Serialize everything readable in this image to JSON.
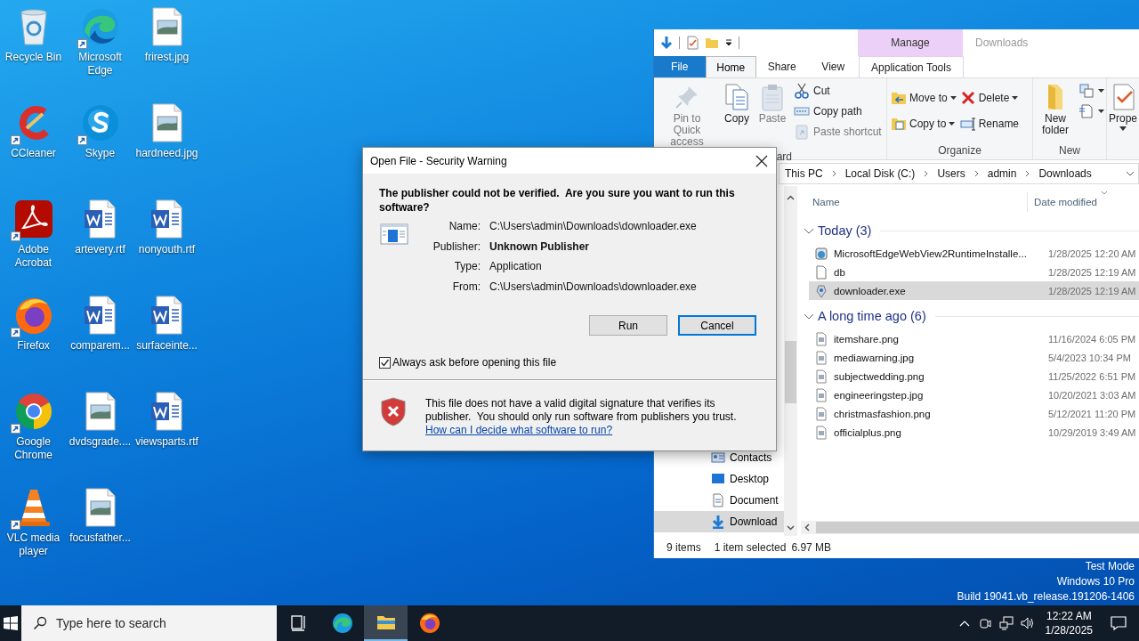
{
  "desktop_icons": [
    {
      "label": "Recycle Bin",
      "kind": "recycle-bin",
      "shortcut": false
    },
    {
      "label": "CCleaner",
      "kind": "ccleaner",
      "shortcut": true
    },
    {
      "label": "Adobe Acrobat",
      "kind": "acrobat",
      "shortcut": true
    },
    {
      "label": "Firefox",
      "kind": "firefox",
      "shortcut": true
    },
    {
      "label": "Google Chrome",
      "kind": "chrome",
      "shortcut": true
    },
    {
      "label": "VLC media player",
      "kind": "vlc",
      "shortcut": true
    },
    {
      "label": "Microsoft Edge",
      "kind": "edge",
      "shortcut": true
    },
    {
      "label": "Skype",
      "kind": "skype",
      "shortcut": true
    },
    {
      "label": "artevery.rtf",
      "kind": "word",
      "shortcut": false
    },
    {
      "label": "comparem...",
      "kind": "word",
      "shortcut": false
    },
    {
      "label": "dvdsgrade....",
      "kind": "image",
      "shortcut": false
    },
    {
      "label": "focusfather...",
      "kind": "image",
      "shortcut": false
    },
    {
      "label": "frirest.jpg",
      "kind": "image",
      "shortcut": false
    },
    {
      "label": "hardneed.jpg",
      "kind": "image",
      "shortcut": false
    },
    {
      "label": "nonyouth.rtf",
      "kind": "word",
      "shortcut": false
    },
    {
      "label": "surfaceinte...",
      "kind": "word",
      "shortcut": false
    },
    {
      "label": "viewsparts.rtf",
      "kind": "word",
      "shortcut": false
    }
  ],
  "explorer": {
    "title": "Downloads",
    "contextual_group": "Manage",
    "tabs": [
      {
        "label": "File",
        "kind": "file",
        "selected": false
      },
      {
        "label": "Home",
        "kind": "normal",
        "selected": true
      },
      {
        "label": "Share",
        "kind": "normal",
        "selected": false
      },
      {
        "label": "View",
        "kind": "normal",
        "selected": false
      },
      {
        "label": "Application Tools",
        "kind": "contextual",
        "selected": false
      }
    ],
    "ribbon_groups": [
      {
        "label": "ard",
        "items": [
          {
            "kind": "large",
            "label": "Pin to Quick access",
            "disabled": true,
            "dropdown": false
          },
          {
            "kind": "large",
            "label": "Copy",
            "disabled": false,
            "dropdown": false
          },
          {
            "kind": "large",
            "label": "Paste",
            "disabled": true,
            "dropdown": false
          },
          {
            "kind": "stack",
            "items": [
              {
                "label": "Cut",
                "disabled": false,
                "dropdown": false
              },
              {
                "label": "Copy path",
                "disabled": false,
                "dropdown": false
              },
              {
                "label": "Paste shortcut",
                "disabled": true,
                "dropdown": false
              }
            ]
          }
        ]
      },
      {
        "label": "Organize",
        "items": [
          {
            "kind": "stack",
            "items": [
              {
                "label": "Move to",
                "disabled": false,
                "dropdown": true
              },
              {
                "label": "Copy to",
                "disabled": false,
                "dropdown": true
              }
            ]
          },
          {
            "kind": "stack",
            "items": [
              {
                "label": "Delete",
                "disabled": false,
                "dropdown": true
              },
              {
                "label": "Rename",
                "disabled": false,
                "dropdown": false
              }
            ]
          }
        ]
      },
      {
        "label": "New",
        "items": [
          {
            "kind": "large",
            "label": "New folder",
            "disabled": false,
            "dropdown": false
          },
          {
            "kind": "stack",
            "items": [
              {
                "disabled": false,
                "dropdown": true
              },
              {
                "disabled": false,
                "dropdown": true
              }
            ]
          }
        ]
      },
      {
        "items": [
          {
            "kind": "large",
            "label": "Prope",
            "disabled": false,
            "dropdown": true
          }
        ]
      }
    ],
    "address": [
      "This PC",
      "Local Disk (C:)",
      "Users",
      "admin",
      "Downloads"
    ],
    "nav_items": [
      {
        "label": "Contacts",
        "selected": false
      },
      {
        "label": "Desktop",
        "selected": false
      },
      {
        "label": "Document",
        "selected": false
      },
      {
        "label": "Download",
        "selected": true
      }
    ],
    "columns": [
      "Name",
      "Date modified"
    ],
    "groups": [
      {
        "label": "Today (3)",
        "expanded": true,
        "files": [
          {
            "name": "MicrosoftEdgeWebView2RuntimeInstalle...",
            "modified": "1/28/2025 12:20 AM",
            "kind": "installer",
            "selected": false
          },
          {
            "name": "db",
            "modified": "1/28/2025 12:19 AM",
            "kind": "blank",
            "selected": false
          },
          {
            "name": "downloader.exe",
            "modified": "1/28/2025 12:19 AM",
            "kind": "exe",
            "selected": true
          }
        ]
      },
      {
        "label": "A long time ago (6)",
        "expanded": true,
        "files": [
          {
            "name": "itemshare.png",
            "modified": "11/16/2024 6:05 PM",
            "kind": "image",
            "selected": false
          },
          {
            "name": "mediawarning.jpg",
            "modified": "5/4/2023 10:34 PM",
            "kind": "image",
            "selected": false
          },
          {
            "name": "subjectwedding.png",
            "modified": "11/25/2022 6:51 PM",
            "kind": "image",
            "selected": false
          },
          {
            "name": "engineeringstep.jpg",
            "modified": "10/20/2021 3:03 AM",
            "kind": "image",
            "selected": false
          },
          {
            "name": "christmasfashion.png",
            "modified": "5/12/2021 11:20 PM",
            "kind": "image",
            "selected": false
          },
          {
            "name": "officialplus.png",
            "modified": "10/29/2019 3:49 AM",
            "kind": "image",
            "selected": false
          }
        ]
      }
    ],
    "status": {
      "count": "9 items",
      "selection": "1 item selected",
      "size": "6.97 MB"
    }
  },
  "dialog": {
    "title": "Open File - Security Warning",
    "heading": "The publisher could not be verified.  Are you sure you want to run this software?",
    "fields": [
      {
        "label": "Name:",
        "value": "C:\\Users\\admin\\Downloads\\downloader.exe",
        "emphasis": false
      },
      {
        "label": "Publisher:",
        "value": "Unknown Publisher",
        "emphasis": true
      },
      {
        "label": "Type:",
        "value": "Application",
        "emphasis": false
      },
      {
        "label": "From:",
        "value": "C:\\Users\\admin\\Downloads\\downloader.exe",
        "emphasis": false
      }
    ],
    "buttons": [
      {
        "label": "Run",
        "default": false
      },
      {
        "label": "Cancel",
        "default": true
      }
    ],
    "checkbox": {
      "label": "Always ask before opening this file",
      "checked": true
    },
    "warning": "This file does not have a valid digital signature that verifies its publisher.  You should only run software from publishers you trust.",
    "link": "How can I decide what software to run?"
  },
  "system_watermark": [
    "Test Mode",
    "Windows 10 Pro",
    "Build 19041.vb_release.191206-1406"
  ],
  "taskbar": {
    "search_placeholder": "Type here to search",
    "apps": [
      {
        "kind": "task-view",
        "active": false
      },
      {
        "kind": "edge",
        "active": false
      },
      {
        "kind": "explorer",
        "active": true
      },
      {
        "kind": "firefox",
        "active": false
      }
    ],
    "time": "12:22 AM",
    "date": "1/28/2025"
  }
}
